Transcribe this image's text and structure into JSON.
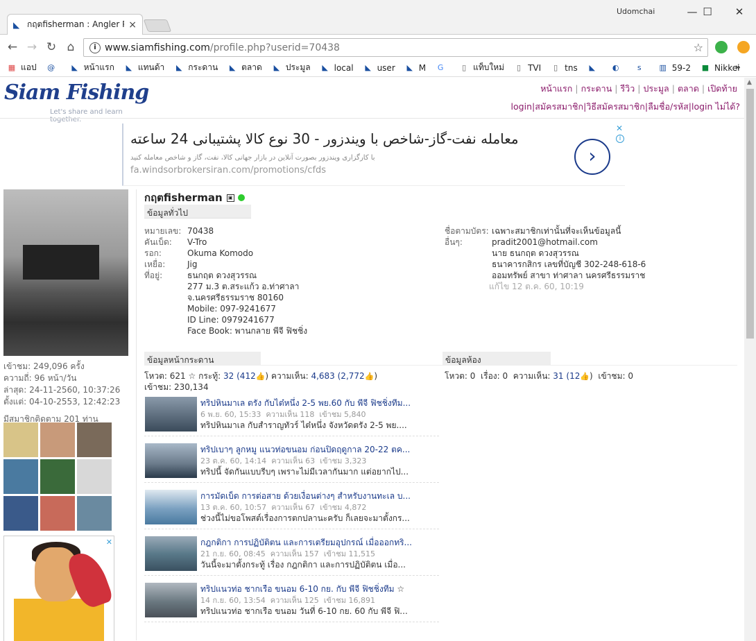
{
  "browser": {
    "tab_title": "กฤตfisherman : Angler Pr",
    "tab_close": "×",
    "window_user": "Udomchai",
    "minimize": "—",
    "maximize": "☐",
    "close": "✕",
    "back": "←",
    "forward": "→",
    "reload": "↻",
    "home": "⌂",
    "info": "i",
    "url_host": "www.siamfishing.com",
    "url_path": "/profile.php?userid=70438",
    "star": "☆",
    "colors": {
      "ext_green": "#3cb24a",
      "ext_orange": "#f5a623"
    }
  },
  "bookmarks": {
    "apps_label": "แอป",
    "items": [
      {
        "label": "",
        "icon": "email-icon"
      },
      {
        "label": "หน้าแรก",
        "icon": "siamfishing-icon"
      },
      {
        "label": "แทนด้า",
        "icon": "siamfishing-icon"
      },
      {
        "label": "กระดาน",
        "icon": "siamfishing-icon"
      },
      {
        "label": "ตลาด",
        "icon": "siamfishing-icon"
      },
      {
        "label": "ประมูล",
        "icon": "siamfishing-icon"
      },
      {
        "label": "local",
        "icon": "siamfishing-icon"
      },
      {
        "label": "user",
        "icon": "siamfishing-icon"
      },
      {
        "label": "M",
        "icon": "siamfishing-icon"
      },
      {
        "label": "",
        "icon": "google-icon"
      },
      {
        "label": "แท็บใหม่",
        "icon": "page-icon"
      },
      {
        "label": "TVI",
        "icon": "page-icon"
      },
      {
        "label": "tns",
        "icon": "page-icon"
      },
      {
        "label": "",
        "icon": "siamfishing-icon"
      },
      {
        "label": "",
        "icon": "yinyang-icon"
      },
      {
        "label": "",
        "icon": "stt-icon"
      },
      {
        "label": "59-2",
        "icon": "building-icon"
      },
      {
        "label": "Nikkei",
        "icon": "nikkei-icon"
      }
    ],
    "more": "»"
  },
  "site": {
    "logo_text": "Siam Fishing",
    "tagline": "Let's share and learn together.",
    "nav": [
      "หน้าแรก",
      "กระดาน",
      "รีวิว",
      "ประมูล",
      "ตลาด",
      "เปิดท้าย"
    ],
    "nav2": [
      "login",
      "สมัครสมาชิก",
      "วิธีสมัครสมาชิก",
      "ลืมชื่อ/รหัส",
      "login ไม่ได้?"
    ]
  },
  "ad": {
    "headline": "معامله نفت-گاز-شاخص با ویندزور - 30 نوع کالا پشتیبانی 24 ساعته",
    "sub": "با کارگزاری ویندزور بصورت آنلاین در بازار جهانی کالا، نفت، گاز و شاخص معامله کنید",
    "url": "fa.windsorbrokersiran.com/promotions/cfds",
    "go": "›",
    "close": "✕",
    "info": "i"
  },
  "profile": {
    "username": "กฤตfisherman",
    "card_icon": "▣",
    "views": "เข้าชม: 249,096 ครั้ง",
    "frequency": "ความถี่: 96 หน้า/วัน",
    "last": "ล่าสุด: 24-11-2560, 10:37:26",
    "since": "ตั้งแต่: 04-10-2553, 12:42:23",
    "followers": "มีสมาชิกติดตาม 201 ท่าน"
  },
  "general": {
    "header": "ข้อมูลทั่วไป",
    "left": [
      {
        "k": "หมายเลข:",
        "v": "70438"
      },
      {
        "k": "คันเบ็ด:",
        "v": "V-Tro"
      },
      {
        "k": "รอก:",
        "v": "Okuma Komodo"
      },
      {
        "k": "เหยื่อ:",
        "v": "Jig"
      },
      {
        "k": "ที่อยู่:",
        "v": "ธนกฤต ดวงสุวรรณ"
      },
      {
        "k": "",
        "v": "277 ม.3 ต.สระแก้ว อ.ท่าศาลา"
      },
      {
        "k": "",
        "v": "จ.นครศรีธรรมราช 80160"
      },
      {
        "k": "",
        "v": "Mobile: 097-9241677"
      },
      {
        "k": "",
        "v": "ID Line: 0979241677"
      },
      {
        "k": "",
        "v": "Face Book: พานกลาย พีจี ฟิชชิ่ง"
      }
    ],
    "right": [
      {
        "k": "ชื่อตามบัตร:",
        "v": "เฉพาะสมาชิกเท่านั้นที่จะเห็นข้อมูลนี้"
      },
      {
        "k": "อื่นๆ:",
        "v": "pradit2001@hotmail.com"
      },
      {
        "k": "",
        "v": "นาย ธนกฤต ดวงสุวรรณ"
      },
      {
        "k": "",
        "v": "ธนาคารกสิกร เลขที่บัญชี 302-248-618-6"
      },
      {
        "k": "",
        "v": "ออมทรัพย์ สาขา ท่าศาลา นครศรีธรรมราช"
      }
    ],
    "edited": "แก้ไข 12 ต.ค. 60, 10:19"
  },
  "board": {
    "header": "ข้อมูลหน้ากระดาน",
    "vote_label": "โหวต: 621",
    "star": "☆",
    "topics_label": "กระทู้:",
    "topics": "32",
    "topics_likes": "(412",
    "comments_label": "ความเห็น:",
    "comments": "4,683",
    "comments_likes": "(2,772",
    "thumb": "👍",
    "close_paren": ")",
    "views": "เข้าชม: 230,134",
    "posts": [
      {
        "title": "ทริปหินมาเล ตรัง กับไต๋หนึ่ง 2-5 พย.60 กับ พีจี ฟิชชิ่งทีม...",
        "date": "6 พ.ย. 60, 15:33",
        "comments": "ความเห็น 118",
        "views": "เข้าชม 5,840",
        "desc": "ทริปหินมาเล กับสำราญทัวร์ ไต๋หนึ่ง จังหวัดตรัง 2-5 พย....",
        "star": ""
      },
      {
        "title": "ทริปเบาๆ ลูกหมู แนวท่อขนอม ก่อนปิดฤดูกาล 20-22 ตค...",
        "date": "23 ต.ค. 60, 14:14",
        "comments": "ความเห็น 63",
        "views": "เข้าชม 3,323",
        "desc": "ทริปนี้ จัดกันแบบรีบๆ เพราะไม่มีเวลากันมาก แต่อยากไป...",
        "star": ""
      },
      {
        "title": "การมัดเบ็ด การต่อสาย ด้วยเงื่อนต่างๆ สำหรับงานทะเล บ...",
        "date": "13 ต.ค. 60, 10:57",
        "comments": "ความเห็น 67",
        "views": "เข้าชม 4,872",
        "desc": "ช่วงนี้ไม่ขอโพสต์เรื่องการตกปลานะครับ ก็เลยจะมาตั้งกร...",
        "star": ""
      },
      {
        "title": "กฎกติกา การปฏิบัติตน และการเตรียมอุปกรณ์ เมื่อออกทริ...",
        "date": "21 ก.ย. 60, 08:45",
        "comments": "ความเห็น 157",
        "views": "เข้าชม 11,515",
        "desc": "วันนี้จะมาตั้งกระทู้ เรื่อง กฎกติกา และการปฏิบัติตน เมื่อ...",
        "star": ""
      },
      {
        "title": "ทริปแนวท่อ ชากเรือ ขนอม 6-10 กย. กับ พีจี ฟิชชิ่งทีม",
        "date": "14 ก.ย. 60, 13:54",
        "comments": "ความเห็น 125",
        "views": "เข้าชม 16,891",
        "desc": "ทริปแนวท่อ ชากเรือ ขนอม วันที่ 6-10 กย. 60 กับ พีจี ฟิ...",
        "star": "☆"
      }
    ]
  },
  "room": {
    "header": "ข้อมูลห้อง",
    "vote_label": "โหวต: 0",
    "stories_label": "เรื่อง: 0",
    "comments_label": "ความเห็น:",
    "comments": "31",
    "comments_likes": "(12",
    "thumb": "👍",
    "close_paren": ")",
    "views": "เข้าชม: 0"
  }
}
